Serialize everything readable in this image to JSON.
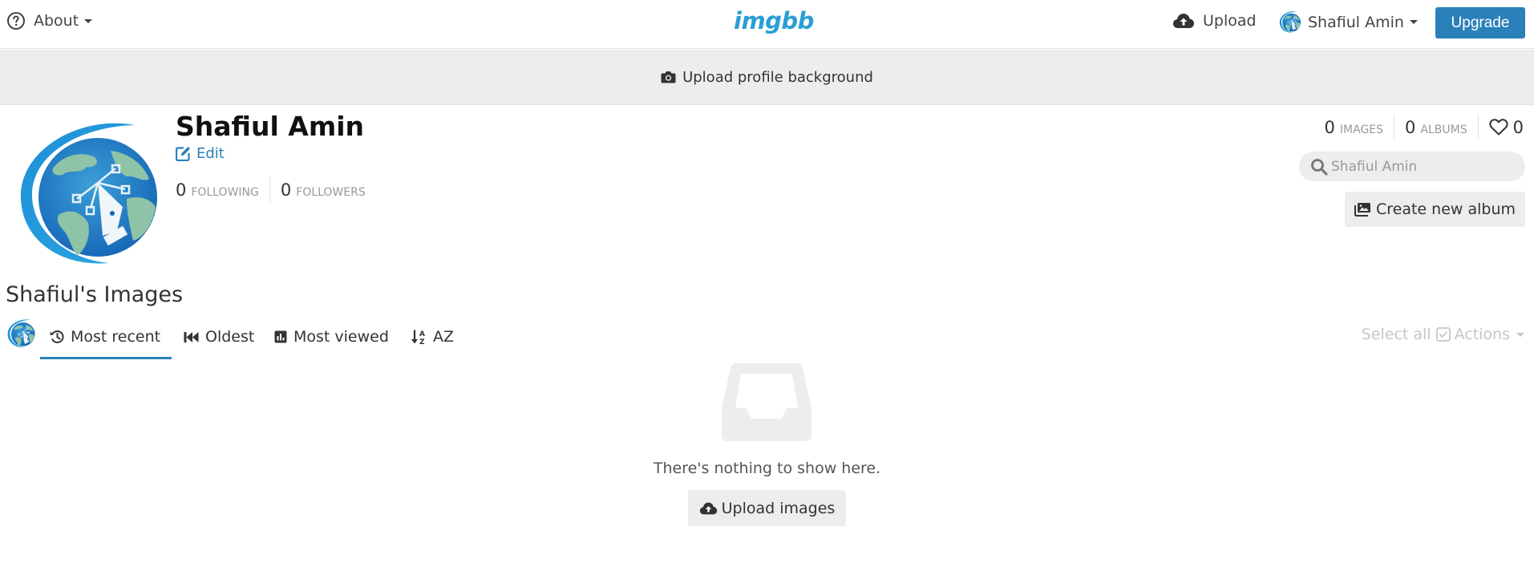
{
  "topbar": {
    "about_label": "About",
    "logo_text": "imgbb",
    "upload_label": "Upload",
    "user_name": "Shafiul Amin",
    "upgrade_label": "Upgrade"
  },
  "background_strip": {
    "label": "Upload profile background"
  },
  "profile": {
    "name": "Shafiul Amin",
    "edit_label": "Edit",
    "following_count": "0",
    "following_label": "Following",
    "followers_count": "0",
    "followers_label": "Followers",
    "images_count": "0",
    "images_label": "Images",
    "albums_count": "0",
    "albums_label": "Albums",
    "likes_count": "0",
    "search_placeholder": "Shafiul Amin",
    "create_album_label": "Create new album"
  },
  "images_section": {
    "title": "Shafiul's Images",
    "tabs": [
      {
        "label": "Most recent",
        "icon": "history-icon",
        "active": true
      },
      {
        "label": "Oldest",
        "icon": "fast-backward-icon",
        "active": false
      },
      {
        "label": "Most viewed",
        "icon": "bar-chart-icon",
        "active": false
      },
      {
        "label": "AZ",
        "icon": "sort-alpha-icon",
        "active": false
      }
    ],
    "select_all_label": "Select all",
    "actions_label": "Actions",
    "empty_text": "There's nothing to show here.",
    "upload_images_label": "Upload images"
  },
  "colors": {
    "accent": "#2a80b9",
    "logo": "#2a9fd6",
    "strip_bg": "#ededed",
    "muted": "#c6c6c6"
  }
}
